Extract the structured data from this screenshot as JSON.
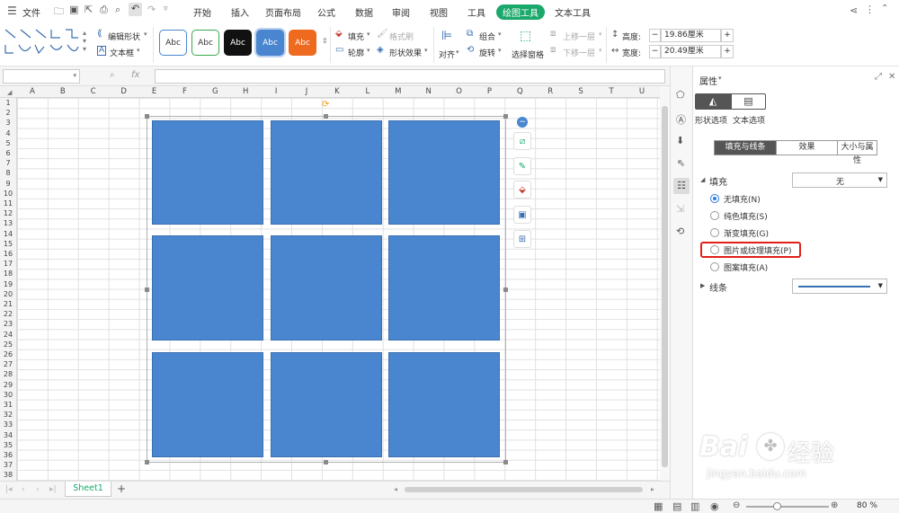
{
  "menubar": {
    "file_label": "文件",
    "tabs": [
      "开始",
      "插入",
      "页面布局",
      "公式",
      "数据",
      "审阅",
      "视图",
      "工具",
      "绘图工具",
      "文本工具"
    ]
  },
  "ribbon": {
    "edit_shape": "编辑形状",
    "text_box": "文本框",
    "style_samples": [
      {
        "label": "Abc",
        "bg": "#ffffff",
        "fg": "#333333",
        "border": "#4a86d0"
      },
      {
        "label": "Abc",
        "bg": "#ffffff",
        "fg": "#333333",
        "border": "#3aa851"
      },
      {
        "label": "Abc",
        "bg": "#111111",
        "fg": "#ffffff",
        "border": "#111111"
      },
      {
        "label": "Abc",
        "bg": "#4a86d0",
        "fg": "#ffffff",
        "border": "#4a86d0"
      },
      {
        "label": "Abc",
        "bg": "#ee6a1f",
        "fg": "#ffffff",
        "border": "#ee6a1f"
      }
    ],
    "fill": "填充",
    "format_painter": "格式刷",
    "outline": "轮廓",
    "shape_effect": "形状效果",
    "align": "对齐",
    "group": "组合",
    "rotate": "旋转",
    "selection_pane": "选择窗格",
    "bring_forward": "上移一层",
    "send_backward": "下移一层",
    "height_label": "高度:",
    "height_value": "19.86厘米",
    "width_label": "宽度:",
    "width_value": "20.49厘米"
  },
  "formula": {
    "fx": "fx"
  },
  "columns": [
    "A",
    "B",
    "C",
    "D",
    "E",
    "F",
    "G",
    "H",
    "I",
    "J",
    "K",
    "L",
    "M",
    "N",
    "O",
    "P",
    "Q",
    "R",
    "S",
    "T",
    "U"
  ],
  "rows": [
    "1",
    "2",
    "3",
    "4",
    "5",
    "6",
    "7",
    "8",
    "9",
    "10",
    "11",
    "12",
    "13",
    "14",
    "15",
    "16",
    "17",
    "18",
    "19",
    "20",
    "21",
    "22",
    "23",
    "24",
    "25",
    "26",
    "27",
    "28",
    "29",
    "30",
    "31",
    "32",
    "33",
    "34",
    "35",
    "36",
    "37",
    "38"
  ],
  "sheet": {
    "name": "Sheet1",
    "add": "+"
  },
  "status": {
    "zoom": "80 %"
  },
  "pane": {
    "title": "属性",
    "shape_options": "形状选项",
    "text_options": "文本选项",
    "tabs": [
      "填充与线条",
      "效果",
      "大小与属性"
    ],
    "fill_section": "填充",
    "fill_value": "无",
    "fill_options": [
      "无填充(N)",
      "纯色填充(S)",
      "渐变填充(G)",
      "图片或纹理填充(P)",
      "图案填充(A)"
    ],
    "line_section": "线条"
  },
  "watermark": {
    "brand": "Bai",
    "brand2": "经验",
    "url": "jingyan.baidu.com"
  },
  "colors": {
    "accent": "#1aa86b",
    "shape_fill": "#4a86d0",
    "highlight": "#e0201a"
  }
}
